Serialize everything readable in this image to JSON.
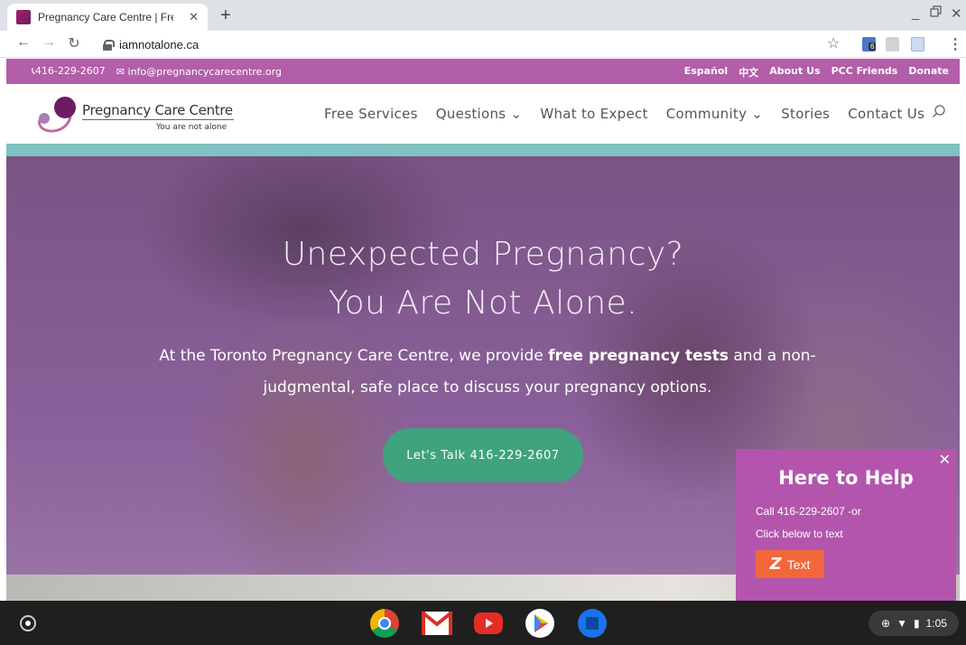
{
  "browser": {
    "tab_title": "Pregnancy Care Centre | Free Un",
    "tab_close": "✕",
    "new_tab": "+",
    "url": "iamnotalone.ca",
    "extension_badge": "6"
  },
  "topbar": {
    "phone": "416-229-2607",
    "email": "info@pregnancycarecentre.org",
    "links": [
      "Español",
      "中文",
      "About Us",
      "PCC Friends",
      "Donate"
    ]
  },
  "logo": {
    "name": "Pregnancy Care Centre",
    "tagline": "You are not alone"
  },
  "nav": {
    "items": [
      "Free Services",
      "Questions ⌄",
      "What to Expect",
      "Community ⌄",
      "Stories",
      "Contact Us"
    ]
  },
  "hero": {
    "title_line1": "Unexpected Pregnancy?",
    "title_line2": "You Are Not Alone.",
    "text_before": "At the Toronto Pregnancy Care Centre, we provide ",
    "text_bold": "free pregnancy tests",
    "text_after": " and a non-judgmental, safe place to discuss your pregnancy options.",
    "cta": "Let's Talk 416-229-2607"
  },
  "help_popup": {
    "close": "✕",
    "title": "Here to Help",
    "line1": "Call 416-229-2607 -or",
    "line2": "Click below to text",
    "button_icon": "Z",
    "button": "Text"
  },
  "shelf": {
    "time": "1:05"
  },
  "colors": {
    "brand_purple": "#b35ea8",
    "teal": "#7fc2c4",
    "cta_green": "#3fa37d",
    "text_button_orange": "#f2663a"
  }
}
